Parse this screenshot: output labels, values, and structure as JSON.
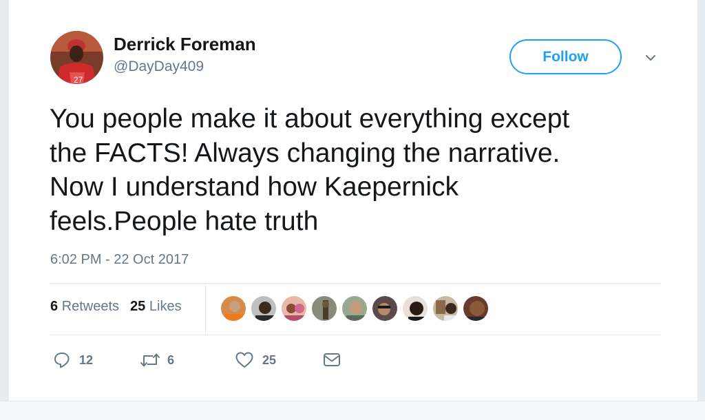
{
  "author": {
    "display_name": "Derrick Foreman",
    "handle": "@DayDay409"
  },
  "follow_button": {
    "label": "Follow"
  },
  "tweet": {
    "lines": [
      "You people make it about everything except",
      "the FACTS! Always changing the narrative.",
      "Now I understand how Kaepernick",
      "feels.People hate truth"
    ],
    "timestamp": "6:02 PM - 22 Oct 2017"
  },
  "stats": {
    "retweets_count": "6",
    "retweets_label": "Retweets",
    "likes_count": "25",
    "likes_label": "Likes"
  },
  "actions": {
    "reply_count": "12",
    "retweet_count": "6",
    "like_count": "25"
  },
  "colors": {
    "brand_blue": "#1da1f2",
    "text_primary": "#14171a",
    "text_secondary": "#657786",
    "divider": "#e1e8ed"
  },
  "icons": [
    "chevron-down-icon",
    "reply-icon",
    "retweet-icon",
    "heart-icon",
    "envelope-icon"
  ]
}
